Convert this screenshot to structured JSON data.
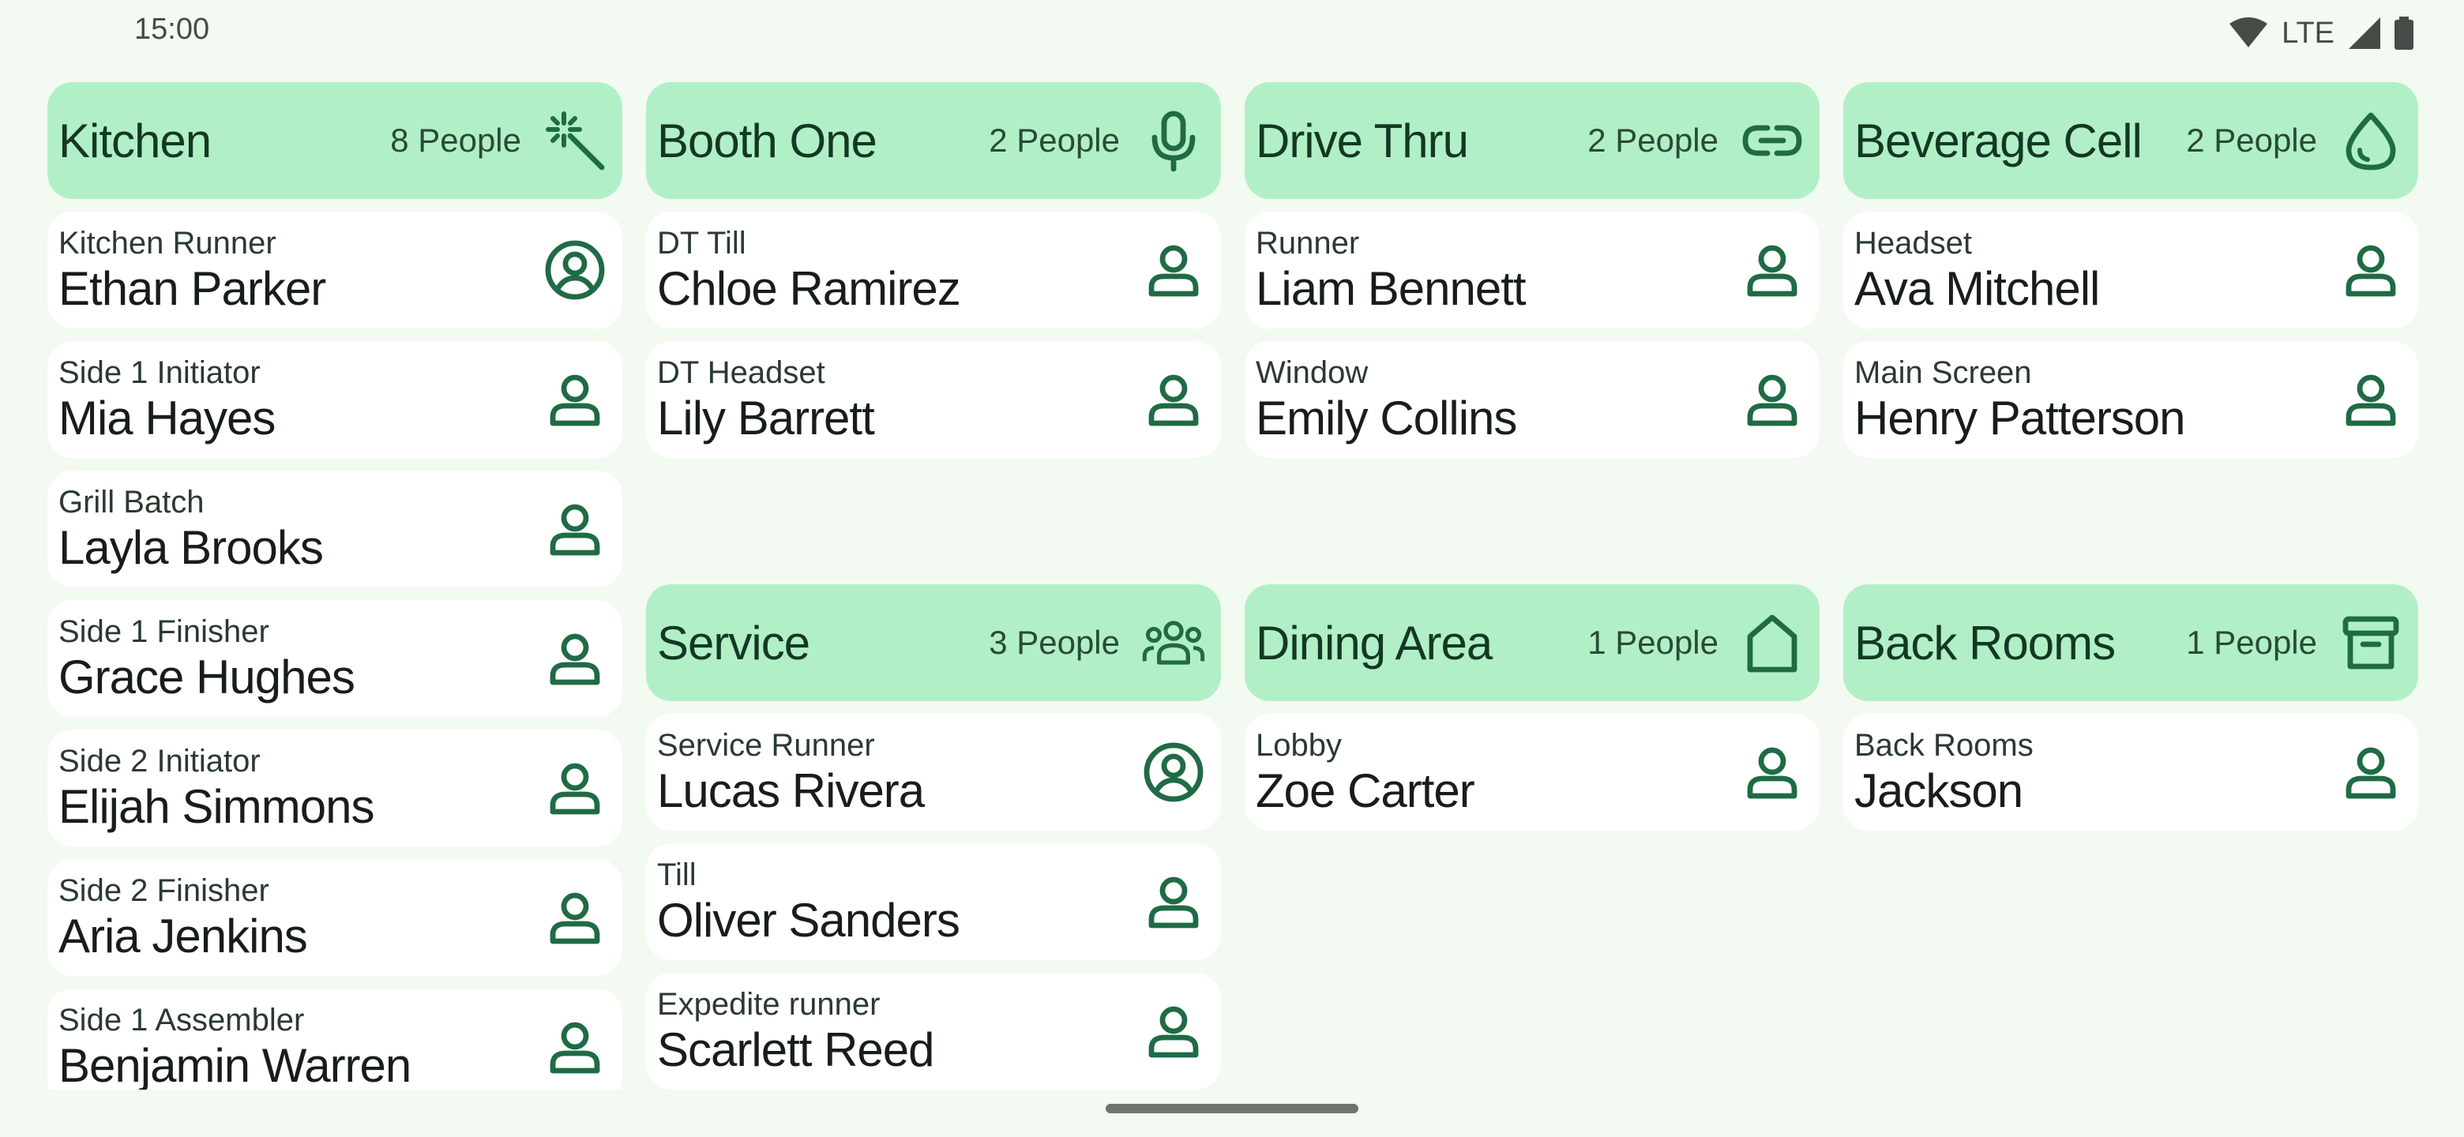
{
  "status_bar": {
    "time": "15:00",
    "network": "LTE"
  },
  "colors": {
    "background": "#f3faf1",
    "header": "#b1f0c6",
    "card": "#ffffff",
    "icon": "#1f6b44"
  },
  "groups": [
    {
      "title": "Kitchen",
      "count": "8 People",
      "icon": "magic-wand-icon",
      "people": [
        {
          "role": "Kitchen Runner",
          "name": "Ethan Parker",
          "icon": "account-circle-icon"
        },
        {
          "role": "Side 1 Initiator",
          "name": "Mia Hayes",
          "icon": "person-icon"
        },
        {
          "role": "Grill Batch",
          "name": "Layla Brooks",
          "icon": "person-icon"
        },
        {
          "role": "Side 1 Finisher",
          "name": "Grace Hughes",
          "icon": "person-icon"
        },
        {
          "role": "Side 2 Initiator",
          "name": "Elijah Simmons",
          "icon": "person-icon"
        },
        {
          "role": "Side 2 Finisher",
          "name": "Aria Jenkins",
          "icon": "person-icon"
        },
        {
          "role": "Side 1 Assembler",
          "name": "Benjamin Warren",
          "icon": "person-icon"
        }
      ]
    },
    {
      "title": "Booth One",
      "count": "2 People",
      "icon": "microphone-icon",
      "people": [
        {
          "role": "DT Till",
          "name": "Chloe Ramirez",
          "icon": "person-icon"
        },
        {
          "role": "DT Headset",
          "name": "Lily Barrett",
          "icon": "person-icon"
        }
      ]
    },
    {
      "title": "Drive Thru",
      "count": "2 People",
      "icon": "link-icon",
      "people": [
        {
          "role": "Runner",
          "name": "Liam Bennett",
          "icon": "person-icon"
        },
        {
          "role": "Window",
          "name": "Emily Collins",
          "icon": "person-icon"
        }
      ]
    },
    {
      "title": "Beverage Cell",
      "count": "2 People",
      "icon": "water-drop-icon",
      "people": [
        {
          "role": "Headset",
          "name": "Ava Mitchell",
          "icon": "person-icon"
        },
        {
          "role": "Main Screen",
          "name": "Henry Patterson",
          "icon": "person-icon"
        }
      ]
    },
    {
      "title": "Service",
      "count": "3 People",
      "icon": "group-icon",
      "people": [
        {
          "role": "Service Runner",
          "name": "Lucas Rivera",
          "icon": "account-circle-icon"
        },
        {
          "role": "Till",
          "name": "Oliver Sanders",
          "icon": "person-icon"
        },
        {
          "role": "Expedite runner",
          "name": "Scarlett Reed",
          "icon": "person-icon"
        }
      ]
    },
    {
      "title": "Dining Area",
      "count": "1 People",
      "icon": "home-icon",
      "people": [
        {
          "role": "Lobby",
          "name": "Zoe Carter",
          "icon": "person-icon"
        }
      ]
    },
    {
      "title": "Back Rooms",
      "count": "1 People",
      "icon": "archive-box-icon",
      "people": [
        {
          "role": "Back Rooms",
          "name": "Jackson",
          "icon": "person-icon"
        }
      ]
    }
  ]
}
